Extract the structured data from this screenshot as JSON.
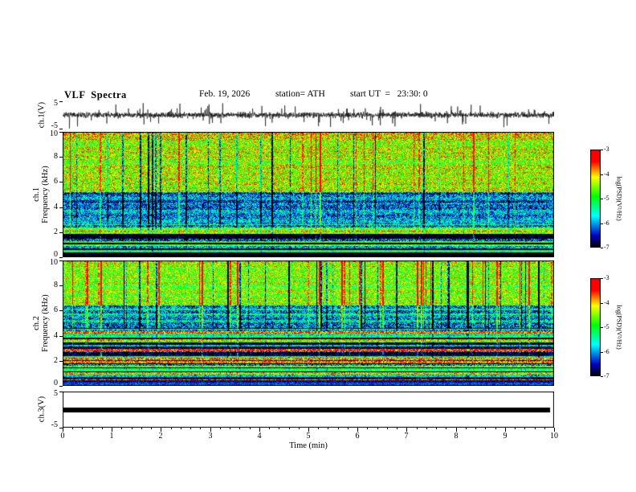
{
  "header": {
    "title": "VLF  Spectra",
    "date": "Feb. 19, 2026",
    "station": "station= ATH",
    "start_ut": "start UT  =   23:30: 0"
  },
  "xaxis": {
    "label": "Time  (min)",
    "range": [
      0,
      10
    ],
    "ticks": [
      0,
      1,
      2,
      3,
      4,
      5,
      6,
      7,
      8,
      9,
      10
    ]
  },
  "panels": {
    "ch1wave": {
      "ylabel": "ch.1(V)",
      "yrange": [
        -5,
        5
      ],
      "yticks": [
        5,
        -5
      ]
    },
    "ch1spec": {
      "ylabel1": "ch.1",
      "ylabel2": "Frequency  (kHz)",
      "yrange": [
        0,
        10
      ],
      "yticks": [
        10,
        8,
        6,
        4,
        2,
        0
      ]
    },
    "ch2spec": {
      "ylabel1": "ch.2",
      "ylabel2": "Frequency  (kHz)",
      "yrange": [
        0,
        10
      ],
      "yticks": [
        10,
        8,
        6,
        4,
        2,
        0
      ]
    },
    "ch3wave": {
      "ylabel": "ch.3(V)",
      "yrange": [
        -5,
        5
      ],
      "yticks": [
        5,
        -5
      ]
    }
  },
  "colorbar": {
    "label": "log(PSD)(V²/Hz)",
    "range": [
      -7,
      -3
    ],
    "ticks": [
      -3,
      -4,
      -5,
      -6,
      -7
    ]
  },
  "chart_data": [
    {
      "id": "ch1_waveform",
      "type": "line",
      "title": "ch.1 voltage time series",
      "x_range_min": [
        0,
        10
      ],
      "y_range_V": [
        -5,
        5
      ],
      "description": "Broadband VLF noise around 0 V (mostly within ±1.5 V) with frequent impulsive sferic spikes reaching ±4–5 V throughout the 10-minute record",
      "gen": {
        "seed": 7,
        "n_points": 2448,
        "noise_amp": 0.5,
        "spike_prob": 0.035,
        "spike_amp": 3.2
      }
    },
    {
      "id": "ch1_spectrogram",
      "type": "heatmap",
      "x_range_min": [
        0,
        10
      ],
      "y_range_kHz": [
        0,
        10
      ],
      "value_label": "log(PSD)(V²/Hz)",
      "value_range": [
        -7,
        -3
      ],
      "colormap": "black-blue-cyan-green-yellow-red",
      "description": "PSD ≈ -4.5 (green/yellow speckle) above ~5 kHz with red bursts near 10 kHz; strong blue band (≈ -6) between ~2.6 and 5.2 kHz; horizontally striped mix with black lines below 2.6 kHz; near-black (≈ -7) below ~0.35 kHz; vertical sferic streaks crossing all frequencies",
      "gen": {
        "seed": 21,
        "streak_prob": 0.09,
        "top_boost_f": 9.3,
        "top_boost": 0.3,
        "bands": [
          {
            "f": [
              5.2,
              10
            ],
            "base": -4.4,
            "noise": 0.9,
            "streak": 1.2,
            "stripe": 0.15
          },
          {
            "f": [
              2.6,
              5.2
            ],
            "base": -6.1,
            "noise": 0.8,
            "streak": 0.9,
            "stripe": 0.3
          },
          {
            "f": [
              1.2,
              2.6
            ],
            "base": -5.3,
            "noise": 0.9,
            "streak": 0.5,
            "stripe": 1.5
          },
          {
            "f": [
              0.35,
              1.2
            ],
            "base": -6.2,
            "noise": 0.7,
            "streak": 0.2,
            "stripe": 1.5
          },
          {
            "f": [
              0,
              0.35
            ],
            "base": -7.0,
            "noise": 0.2,
            "streak": 0,
            "stripe": 0
          }
        ]
      }
    },
    {
      "id": "ch2_spectrogram",
      "type": "heatmap",
      "x_range_min": [
        0,
        10
      ],
      "y_range_kHz": [
        0,
        10
      ],
      "value_label": "log(PSD)(V²/Hz)",
      "value_range": [
        -7,
        -3
      ],
      "colormap": "black-blue-cyan-green-yellow-red",
      "description": "Green speckle with dense blue vertical streaks above ~6.4 kHz; bluish band ~4.6–6.4 kHz; strong horizontal line structure (green/yellow/red rows with black lines) below ~4.6 kHz; near-black below ~0.4 kHz",
      "gen": {
        "seed": 33,
        "streak_prob": 0.1,
        "top_boost_f": 9.4,
        "top_boost": 0.2,
        "bands": [
          {
            "f": [
              6.4,
              10
            ],
            "base": -4.6,
            "noise": 0.85,
            "streak": 1.3,
            "stripe": 0.2
          },
          {
            "f": [
              4.6,
              6.4
            ],
            "base": -5.7,
            "noise": 0.9,
            "streak": 1.0,
            "stripe": 0.4
          },
          {
            "f": [
              2.2,
              4.6
            ],
            "base": -4.9,
            "noise": 0.8,
            "streak": 0.4,
            "stripe": 1.6
          },
          {
            "f": [
              0.4,
              2.2
            ],
            "base": -5.5,
            "noise": 0.8,
            "streak": 0.25,
            "stripe": 1.8
          },
          {
            "f": [
              0,
              0.4
            ],
            "base": -6.8,
            "noise": 0.3,
            "streak": 0,
            "stripe": 0.6
          }
        ]
      }
    },
    {
      "id": "ch3_waveform",
      "type": "line",
      "x_range_min": [
        0,
        10
      ],
      "y_range_V": [
        -5,
        5
      ],
      "constant_value_V": 0,
      "description": "Flat saturated trace drawn as a thick black bar at 0 V for the full record",
      "gen": {
        "thickness_px": 6
      }
    }
  ]
}
